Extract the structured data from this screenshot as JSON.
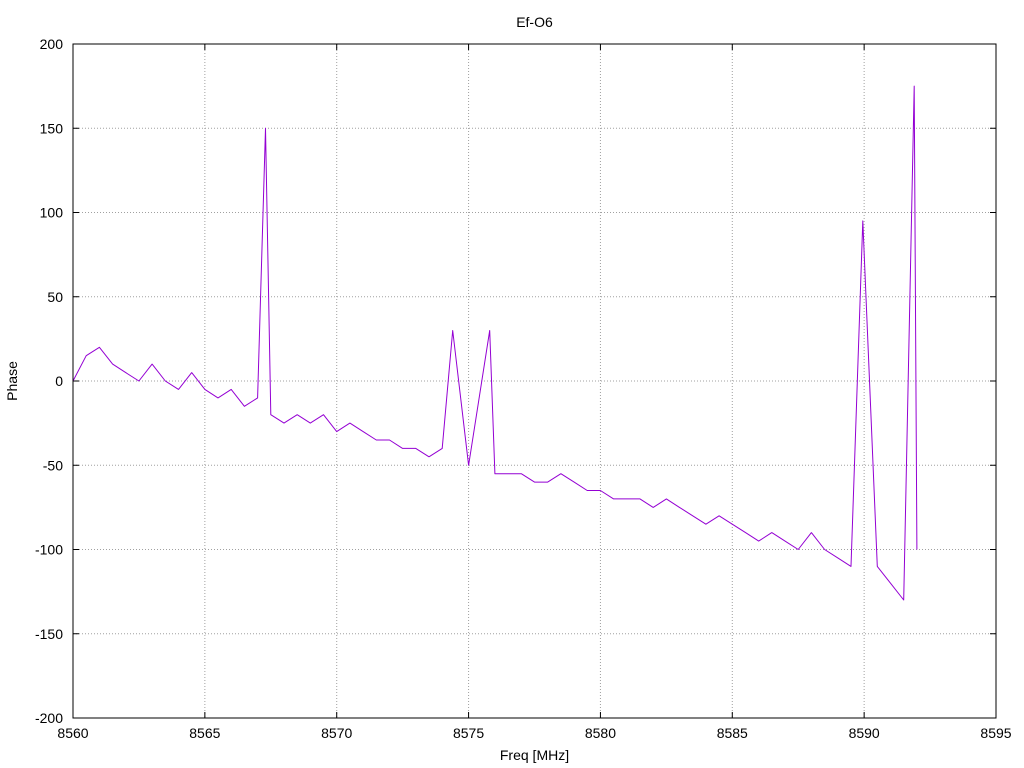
{
  "chart_data": {
    "type": "line",
    "title": "Ef-O6",
    "xlabel": "Freq [MHz]",
    "ylabel": "Phase",
    "xlim": [
      8560,
      8595
    ],
    "ylim": [
      -200,
      200
    ],
    "x_ticks": [
      "8560",
      "8565",
      "8570",
      "8575",
      "8580",
      "8585",
      "8590",
      "8595"
    ],
    "y_ticks": [
      "-200",
      "-150",
      "-100",
      "-50",
      "0",
      "50",
      "100",
      "150",
      "200"
    ],
    "grid": true,
    "legend": "none",
    "line_color": "#9400d3",
    "series": [
      {
        "x": [
          8560.0,
          8560.5,
          8561.0,
          8561.5,
          8562.0,
          8562.5,
          8563.0,
          8563.5,
          8564.0,
          8564.5,
          8565.0,
          8565.5,
          8566.0,
          8566.5,
          8567.0,
          8567.3,
          8567.5,
          8568.0,
          8568.5,
          8569.0,
          8569.5,
          8570.0,
          8570.5,
          8571.0,
          8571.5,
          8572.0,
          8572.5,
          8573.0,
          8573.5,
          8574.0,
          8574.4,
          8575.0,
          8575.8,
          8576.0,
          8576.5,
          8577.0,
          8577.5,
          8578.0,
          8578.5,
          8579.0,
          8579.5,
          8580.0,
          8580.5,
          8581.0,
          8581.5,
          8582.0,
          8582.5,
          8583.0,
          8583.5,
          8584.0,
          8584.5,
          8585.0,
          8585.5,
          8586.0,
          8586.5,
          8587.0,
          8587.5,
          8588.0,
          8588.5,
          8589.0,
          8589.5,
          8589.95,
          8590.5,
          8591.0,
          8591.5,
          8591.9,
          8592.0
        ],
        "values": [
          0,
          15,
          20,
          10,
          5,
          0,
          10,
          0,
          -5,
          5,
          -5,
          -10,
          -5,
          -15,
          -10,
          150,
          -20,
          -25,
          -20,
          -25,
          -20,
          -30,
          -25,
          -30,
          -35,
          -35,
          -40,
          -40,
          -45,
          -40,
          30,
          -50,
          30,
          -55,
          -55,
          -55,
          -60,
          -60,
          -55,
          -60,
          -65,
          -65,
          -70,
          -70,
          -70,
          -75,
          -70,
          -75,
          -80,
          -85,
          -80,
          -85,
          -90,
          -95,
          -90,
          -95,
          -100,
          -90,
          -100,
          -105,
          -110,
          95,
          -110,
          -120,
          -130,
          175,
          -100
        ]
      }
    ]
  }
}
